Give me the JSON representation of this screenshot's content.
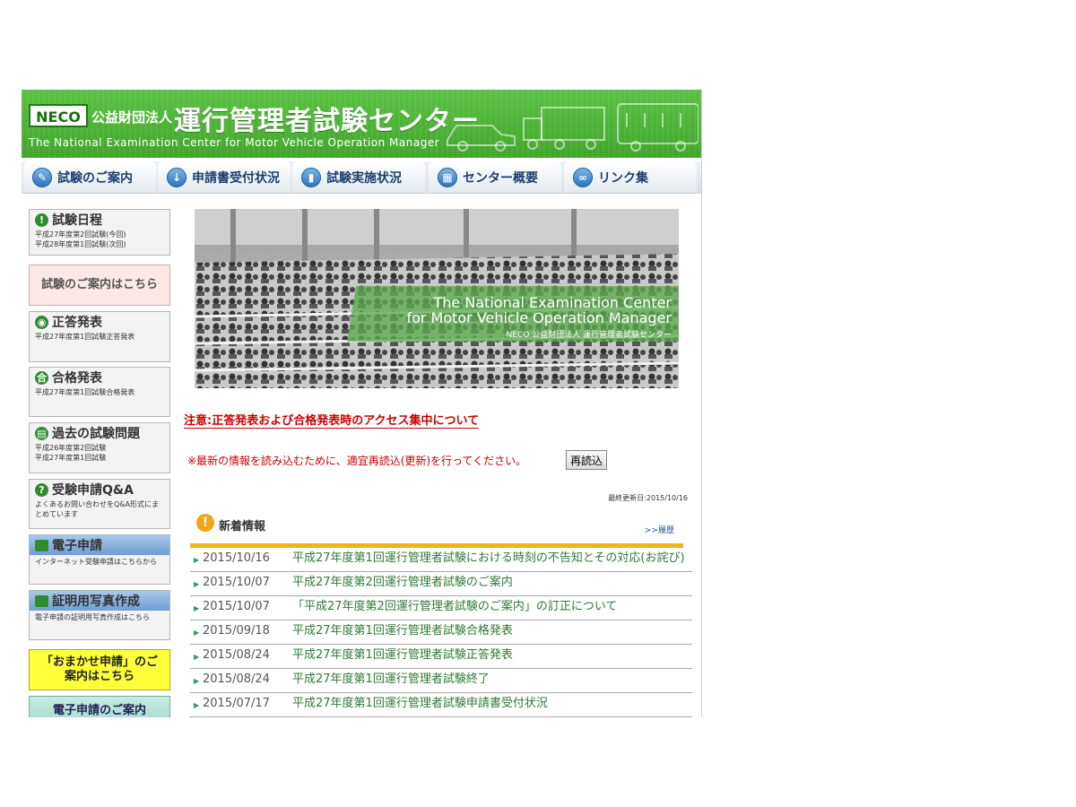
{
  "header": {
    "logo": "NECO",
    "org_type": "公益財団法人",
    "title": "運行管理者試験センター",
    "subtitle": "The National Examination Center for Motor Vehicle Operation Manager"
  },
  "nav": [
    {
      "label": "試験のご案内",
      "icon": "pencil-icon"
    },
    {
      "label": "申請書受付状況",
      "icon": "download-icon"
    },
    {
      "label": "試験実施状況",
      "icon": "bar-chart-icon"
    },
    {
      "label": "センター概要",
      "icon": "building-icon"
    },
    {
      "label": "リンク集",
      "icon": "link-icon"
    }
  ],
  "sidebar": {
    "schedule": {
      "title": "試験日程",
      "lines": [
        "平成27年度第2回試験(今回)",
        "平成28年度第1回試験(次回)"
      ]
    },
    "exam_guide_button": "試験のご案内はこちら",
    "answers": {
      "title": "正答発表",
      "lines": [
        "平成27年度第1回試験正答発表"
      ]
    },
    "pass": {
      "title": "合格発表",
      "lines": [
        "平成27年度第1回試験合格発表"
      ]
    },
    "past": {
      "title": "過去の試験問題",
      "lines": [
        "平成26年度第2回試験",
        "平成27年度第1回試験"
      ]
    },
    "qa": {
      "title": "受験申請Q&A",
      "lines": [
        "よくあるお問い合わせをQ&A形式にまとめています"
      ]
    },
    "e_apply": {
      "title": "電子申請",
      "lines": [
        "インターネット受験申請はこちらから"
      ]
    },
    "photo": {
      "title": "証明用写真作成",
      "lines": [
        "電子申請の証明用写真作成はこちら"
      ]
    },
    "omakase_button": "「おまかせ申請」のご案内はこちら",
    "e_apply_guide_button": "電子申請のご案内"
  },
  "banner": {
    "line1": "The National Examination Center",
    "line2": "for Motor Vehicle Operation Manager",
    "logo_text": "NECO 公益財団法人 運行管理者試験センター"
  },
  "notice_link": "注意:正答発表および合格発表時のアクセス集中について",
  "reload_note": "※最新の情報を読み込むために、適宜再読込(更新)を行ってください。",
  "reload_button": "再読込",
  "last_updated": "最終更新日:2015/10/16",
  "news": {
    "title": "新着情報",
    "history_link": ">>履歴",
    "items": [
      {
        "date": "2015/10/16",
        "title": "平成27年度第1回運行管理者試験における時刻の不告知とその対応(お詫び)"
      },
      {
        "date": "2015/10/07",
        "title": "平成27年度第2回運行管理者試験のご案内"
      },
      {
        "date": "2015/10/07",
        "title": "「平成27年度第2回運行管理者試験のご案内」の訂正について"
      },
      {
        "date": "2015/09/18",
        "title": "平成27年度第1回運行管理者試験合格発表"
      },
      {
        "date": "2015/08/24",
        "title": "平成27年度第1回運行管理者試験正答発表"
      },
      {
        "date": "2015/08/24",
        "title": "平成27年度第1回運行管理者試験終了"
      },
      {
        "date": "2015/07/17",
        "title": "平成27年度第1回運行管理者試験申請書受付状況"
      }
    ]
  }
}
